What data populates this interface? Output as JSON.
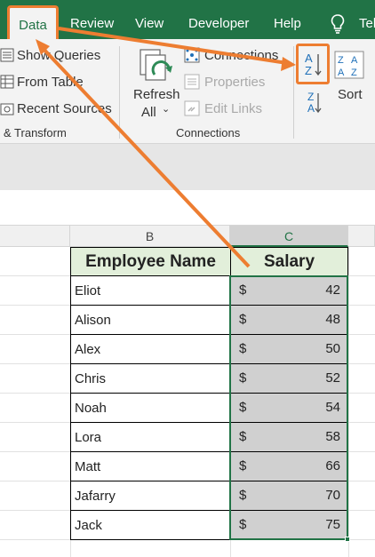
{
  "tabs": {
    "data": "Data",
    "review": "Review",
    "view": "View",
    "developer": "Developer",
    "help": "Help",
    "tell": "Tel"
  },
  "ribbon": {
    "get_transform": {
      "show_queries": "Show Queries",
      "from_table": "From Table",
      "recent_sources": "Recent Sources",
      "group_label": "& Transform"
    },
    "connections": {
      "refresh_all_line1": "Refresh",
      "refresh_all_line2": "All",
      "connections": "Connections",
      "properties": "Properties",
      "edit_links": "Edit Links",
      "group_label": "Connections"
    },
    "sort": {
      "sort_label": "Sort"
    }
  },
  "sheet": {
    "columns": [
      "B",
      "C"
    ],
    "headers": {
      "name": "Employee Name",
      "salary": "Salary"
    },
    "currency": "$",
    "rows": [
      {
        "name": "Eliot",
        "salary": "42"
      },
      {
        "name": "Alison",
        "salary": "48"
      },
      {
        "name": "Alex",
        "salary": "50"
      },
      {
        "name": "Chris",
        "salary": "52"
      },
      {
        "name": "Noah",
        "salary": "54"
      },
      {
        "name": "Lora",
        "salary": "58"
      },
      {
        "name": "Matt",
        "salary": "66"
      },
      {
        "name": "Jafarry",
        "salary": "70"
      },
      {
        "name": "Jack",
        "salary": "75"
      }
    ]
  },
  "colors": {
    "ribbon_green": "#217346",
    "highlight_orange": "#ed7d31",
    "header_fill": "#e2efda",
    "selection_fill": "#d0d0d0"
  }
}
